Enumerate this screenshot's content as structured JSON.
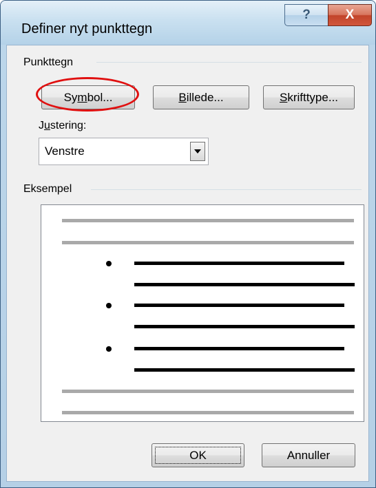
{
  "window": {
    "title": "Definer nyt punkttegn",
    "help_glyph": "?",
    "close_glyph": "X"
  },
  "bullet_group": {
    "label": "Punkttegn",
    "symbol_button": {
      "prefix": "Sy",
      "mnemonic": "m",
      "suffix": "bol..."
    },
    "picture_button": {
      "prefix": "",
      "mnemonic": "B",
      "suffix": "illede..."
    },
    "font_button": {
      "prefix": "",
      "mnemonic": "S",
      "suffix": "krifttype..."
    }
  },
  "alignment": {
    "label_prefix": "J",
    "label_mnemonic": "u",
    "label_suffix": "stering:",
    "selected": "Venstre",
    "dropdown_icon": "triangle-down"
  },
  "preview_group": {
    "label": "Eksempel",
    "bullet_count": 3
  },
  "footer": {
    "ok_label": "OK",
    "cancel_label": "Annuller"
  },
  "colors": {
    "highlight": "#e01010",
    "close_button": "#c2442a",
    "dialog_bg": "#f0f0f0"
  }
}
